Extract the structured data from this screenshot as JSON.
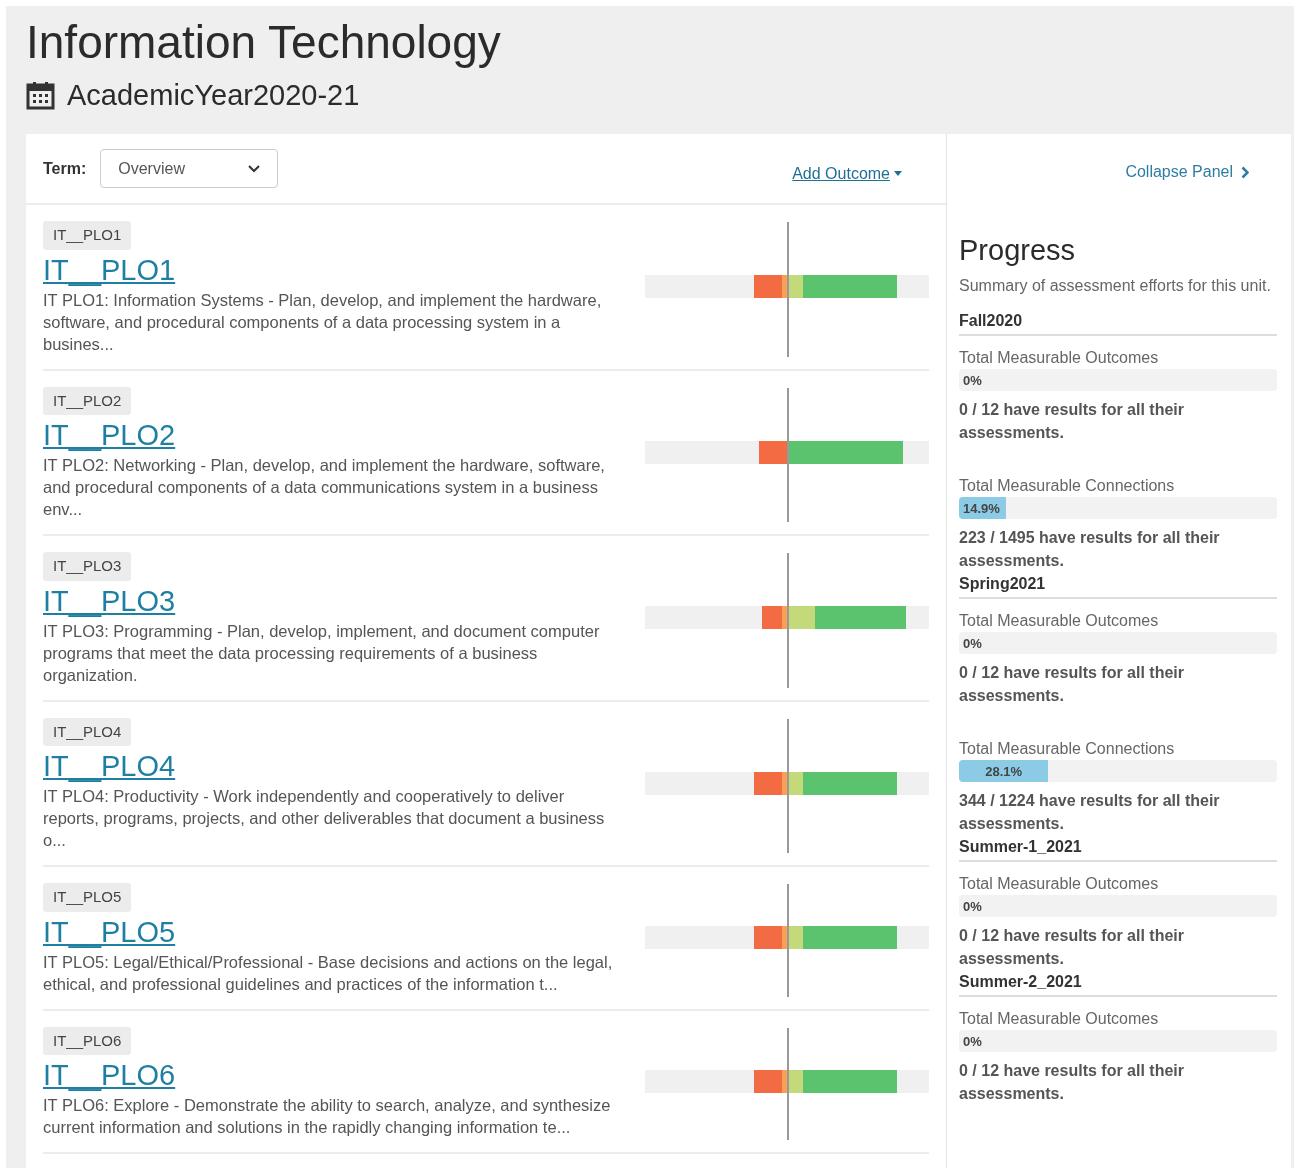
{
  "header": {
    "title": "Information Technology",
    "subtitle": "AcademicYear2020-21"
  },
  "toolbar": {
    "term_label": "Term:",
    "term_value": "Overview",
    "add_outcome": "Add Outcome"
  },
  "outcomes": [
    {
      "tag": "IT__PLO1",
      "title": "IT__PLO1",
      "description": "IT PLO1: Information Systems - Plan, develop, and implement the hardware, software, and procedural components of a data processing system in a busines...",
      "negative": [
        {
          "color": "#f26b43"
        },
        {
          "color": "#f9a052"
        }
      ],
      "positive": [
        {
          "color": "#c3d97a"
        },
        {
          "color": "#5bc26e"
        }
      ]
    },
    {
      "tag": "IT__PLO2",
      "title": "IT__PLO2",
      "description": "IT PLO2: Networking - Plan, develop, and implement the hardware, software, and procedural components of a data communications system in a business env...",
      "negative": [
        {
          "color": "#f26b43"
        }
      ],
      "positive": [
        {
          "color": "#5bc26e"
        }
      ]
    },
    {
      "tag": "IT__PLO3",
      "title": "IT__PLO3",
      "description": "IT PLO3: Programming - Plan, develop, implement, and document computer programs that meet the data processing requirements of a business organization.",
      "negative": [
        {
          "color": "#f26b43"
        },
        {
          "color": "#f9a052"
        }
      ],
      "positive": [
        {
          "color": "#c3d97a"
        },
        {
          "color": "#5bc26e"
        }
      ]
    },
    {
      "tag": "IT__PLO4",
      "title": "IT__PLO4",
      "description": "IT PLO4: Productivity - Work independently and cooperatively to deliver reports, programs, projects, and other deliverables that document a business o...",
      "negative": [
        {
          "color": "#f26b43"
        },
        {
          "color": "#f9a052"
        }
      ],
      "positive": [
        {
          "color": "#c3d97a"
        },
        {
          "color": "#5bc26e"
        }
      ]
    },
    {
      "tag": "IT__PLO5",
      "title": "IT__PLO5",
      "description": "IT PLO5: Legal/Ethical/Professional - Base decisions and actions on the legal, ethical, and professional guidelines and practices of the information t...",
      "negative": [
        {
          "color": "#f26b43"
        },
        {
          "color": "#f9a052"
        }
      ],
      "positive": [
        {
          "color": "#c3d97a"
        },
        {
          "color": "#5bc26e"
        }
      ]
    },
    {
      "tag": "IT__PLO6",
      "title": "IT__PLO6",
      "description": "IT PLO6: Explore - Demonstrate the ability to search, analyze, and synthesize current information and solutions in the rapidly changing information te...",
      "negative": [
        {
          "color": "#f26b43"
        },
        {
          "color": "#f9a052"
        }
      ],
      "positive": [
        {
          "color": "#c3d97a"
        },
        {
          "color": "#5bc26e"
        }
      ]
    }
  ],
  "progress_panel": {
    "collapse": "Collapse Panel",
    "title": "Progress",
    "subtitle": "Summary of assessment efforts for this unit.",
    "terms": [
      {
        "name": "Fall2020",
        "metrics": [
          {
            "label": "Total Measurable Outcomes",
            "reading": "0%",
            "level": 0,
            "summary": "0 / 12 have results for all their assessments."
          },
          {
            "label": "Total Measurable Connections",
            "reading": "14.9%",
            "level": 0.149,
            "summary": "223 / 1495 have results for all their assessments."
          }
        ]
      },
      {
        "name": "Spring2021",
        "metrics": [
          {
            "label": "Total Measurable Outcomes",
            "reading": "0%",
            "level": 0,
            "summary": "0 / 12 have results for all their assessments."
          },
          {
            "label": "Total Measurable Connections",
            "reading": "28.1%",
            "level": 0.281,
            "summary": "344 / 1224 have results for all their assessments."
          }
        ]
      },
      {
        "name": "Summer-1_2021",
        "metrics": [
          {
            "label": "Total Measurable Outcomes",
            "reading": "0%",
            "level": 0,
            "summary": "0 / 12 have results for all their assessments."
          }
        ]
      },
      {
        "name": "Summer-2_2021",
        "metrics": [
          {
            "label": "Total Measurable Outcomes",
            "reading": "0%",
            "level": 0,
            "summary": "0 / 12 have results for all their assessments."
          }
        ]
      }
    ]
  }
}
